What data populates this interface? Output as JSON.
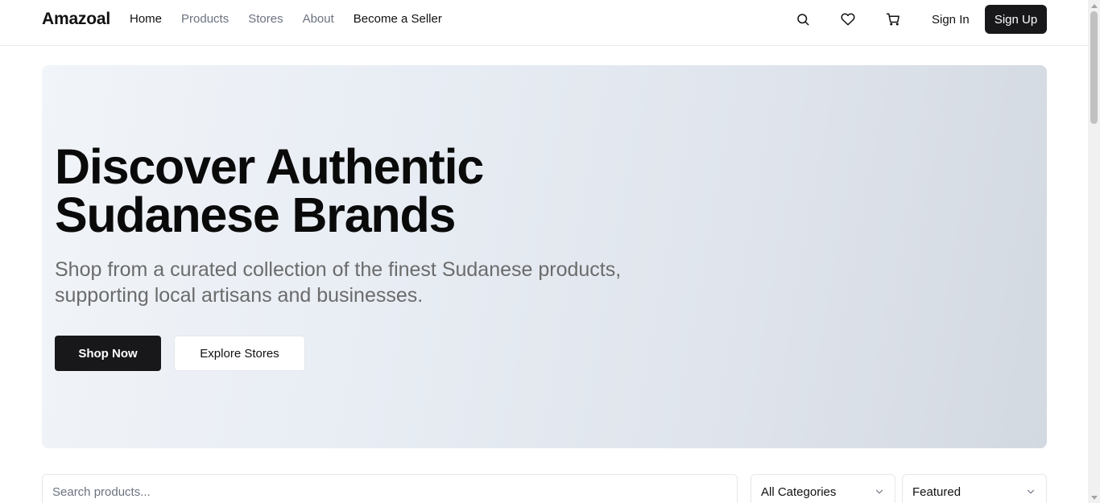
{
  "brand": {
    "name": "Amazoal"
  },
  "nav": {
    "items": [
      {
        "label": "Home"
      },
      {
        "label": "Products"
      },
      {
        "label": "Stores"
      },
      {
        "label": "About"
      },
      {
        "label": "Become a Seller"
      }
    ]
  },
  "header_actions": {
    "icons": [
      "search-icon",
      "heart-icon",
      "cart-icon"
    ],
    "sign_in": "Sign In",
    "sign_up": "Sign Up"
  },
  "hero": {
    "title_line1": "Discover Authentic",
    "title_line2": "Sudanese Brands",
    "subtitle_line1": "Shop from a curated collection of the finest Sudanese products,",
    "subtitle_line2": "supporting local artisans and businesses.",
    "primary_button": "Shop Now",
    "secondary_button": "Explore Stores"
  },
  "filters": {
    "search_placeholder": "Search products...",
    "search_value": "",
    "category_selected": "All Categories",
    "sort_selected": "Featured"
  },
  "colors": {
    "primary": "#18181b",
    "muted_text": "#6b7280",
    "border": "#e5e7eb",
    "hero_gradient_start": "#f1f4f8",
    "hero_gradient_end": "#d3d9e1"
  }
}
